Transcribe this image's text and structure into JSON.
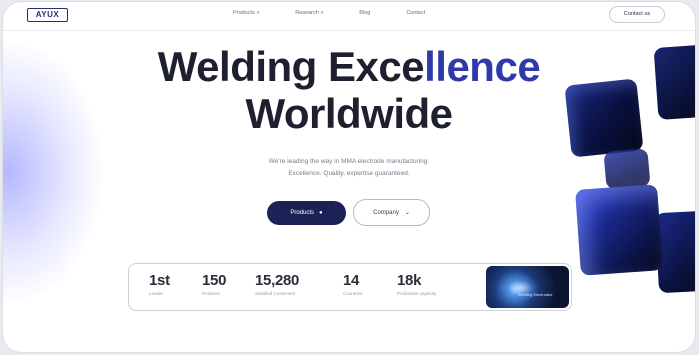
{
  "nav": {
    "logo": "AYUX",
    "links": [
      {
        "label": "Products",
        "has_dropdown": true
      },
      {
        "label": "Research",
        "has_dropdown": true
      },
      {
        "label": "Blog",
        "has_dropdown": false
      },
      {
        "label": "Contact",
        "has_dropdown": false
      }
    ],
    "cta": "Contact us"
  },
  "hero": {
    "title_part1": "Welding Exce",
    "title_accent": "llence",
    "title_line2": "Worldwide",
    "subtitle_line1": "We're leading the way in MMA electrode manufacturing.",
    "subtitle_line2": "Excellence. Quality, expertise guaranteed.",
    "primary_button": "Products",
    "secondary_button": "Company"
  },
  "stats": [
    {
      "value": "1st",
      "label": "Leader"
    },
    {
      "value": "150",
      "label": "Products"
    },
    {
      "value": "15,280",
      "label": "Satisfied Customers"
    },
    {
      "value": "14",
      "label": "Countries"
    },
    {
      "value": "18k",
      "label": "Production capacity"
    }
  ],
  "thumbnail": {
    "caption": "Welding Electrodes"
  },
  "colors": {
    "accent": "#2f39a8",
    "primary_button": "#1c2255",
    "text_dark": "#1e2030"
  }
}
